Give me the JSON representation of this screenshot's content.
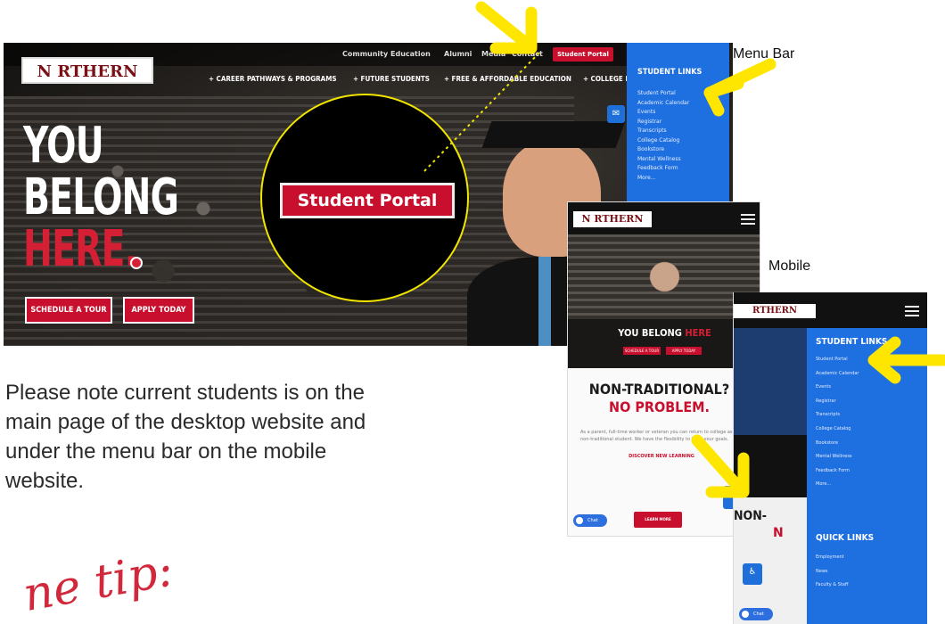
{
  "desktop": {
    "logo": "N RTHERN",
    "util_links": [
      "Community Education",
      "Alumni",
      "Media",
      "Contact"
    ],
    "student_portal_btn": "Student Portal",
    "nav": [
      "+ CAREER PATHWAYS & PROGRAMS",
      "+ FUTURE STUDENTS",
      "+ FREE & AFFORDABLE EDUCATION",
      "+ COLLEGE EXP"
    ],
    "hero_line1": "YOU",
    "hero_line2": "BELONG",
    "hero_line3": "HERE.",
    "schedule_btn": "SCHEDULE A TOUR",
    "apply_btn": "APPLY TODAY",
    "sidebar_title": "STUDENT LINKS",
    "sidebar_items": [
      "Student Portal",
      "Academic Calendar",
      "Events",
      "Registrar",
      "Transcripts",
      "College Catalog",
      "Bookstore",
      "Mental Wellness",
      "Feedback Form",
      "More..."
    ]
  },
  "magnifier": {
    "portal_label": "Student Portal"
  },
  "labels": {
    "menu_bar": "Menu Bar",
    "mobile": "Mobile"
  },
  "mobile1": {
    "logo": "N RTHERN",
    "tagline_white": "YOU BELONG",
    "tagline_red": "HERE",
    "mini_btn1": "SCHEDULE A TOUR",
    "mini_btn2": "APPLY TODAY",
    "nontrad_line1": "NON-TRADITIONAL?",
    "nontrad_line2": "NO PROBLEM.",
    "paragraph": "As a parent, full-time worker or veteran you can return to college as a non-traditional student. We have the flexibility to fulfill your goals.",
    "red_link": "DISCOVER NEW LEARNING",
    "learn_btn": "LEARN MORE",
    "chat": "Chat"
  },
  "mobile2": {
    "logo": "RTHERN",
    "peek_text": "NON-",
    "peek_red": "N",
    "student_title": "STUDENT LINKS",
    "student_items": [
      "Student Portal",
      "Academic Calendar",
      "Events",
      "Registrar",
      "Transcripts",
      "College Catalog",
      "Bookstore",
      "Mental Wellness",
      "Feedback Form",
      "More..."
    ],
    "quick_title": "QUICK LINKS",
    "quick_items": [
      "Employment",
      "News",
      "Faculty & Staff"
    ],
    "chat": "Chat"
  },
  "note": "Please note current students is on the main page of the desktop website and under the menu bar on the mobile website.",
  "script_text": "ne tip:",
  "colors": {
    "brand_red": "#c8102e",
    "menu_blue": "#1e6fe0",
    "arrow_yellow": "#ffe600"
  }
}
